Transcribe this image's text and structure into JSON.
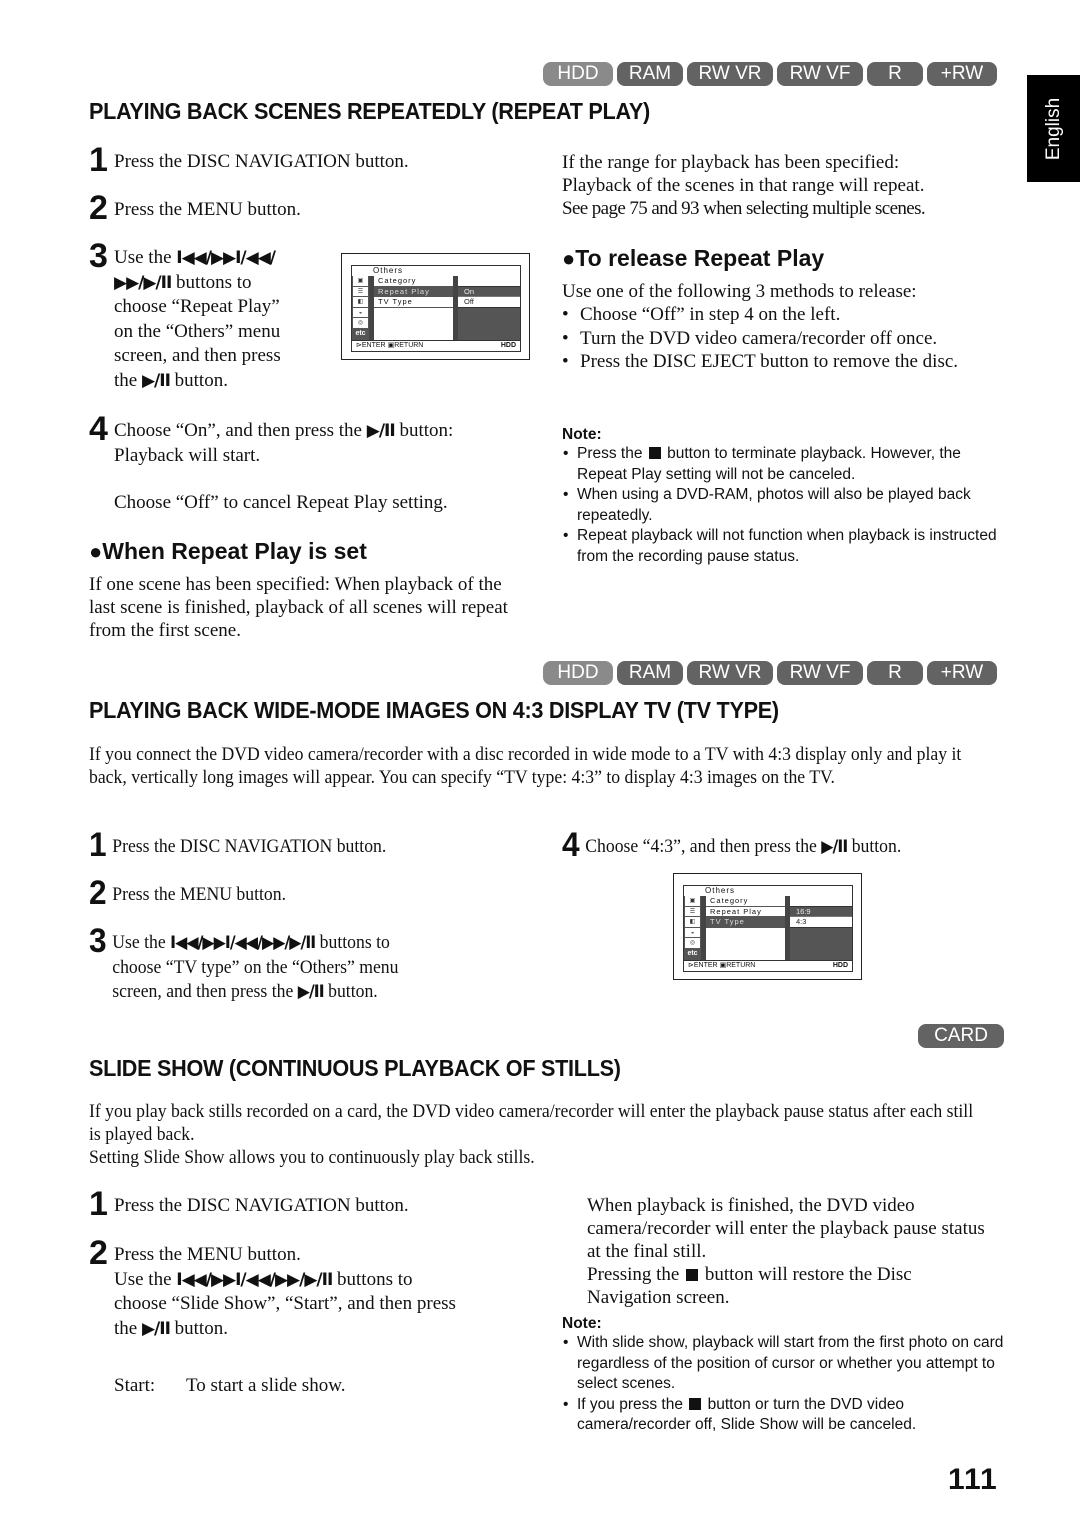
{
  "media_badges_top": [
    "HDD",
    "RAM",
    "RW VR",
    "RW VF",
    "R",
    "+RW"
  ],
  "language_tab": "English",
  "repeat_play": {
    "heading": "PLAYING BACK SCENES REPEATEDLY (REPEAT PLAY)",
    "steps": [
      {
        "num": "1",
        "text": "Press the DISC NAVIGATION button."
      },
      {
        "num": "2",
        "text": "Press the MENU button."
      },
      {
        "num": "3",
        "pre": "Use the",
        "glyphs_line1": "I◀◀/▶▶I/◀◀/",
        "glyphs_line2": "▶▶/▶/II",
        "after_glyphs": "buttons to",
        "lines": [
          "choose “Repeat Play”",
          "on the “Others” menu",
          "screen, and then press"
        ],
        "last_pre": "the",
        "last_glyph": "▶/II",
        "last_post": "button."
      },
      {
        "num": "4",
        "pre": "Choose “On”, and then press the",
        "glyph": "▶/II",
        "post": "button:",
        "line2": "Playback will start.",
        "extra": "Choose “Off” to cancel Repeat Play setting."
      }
    ],
    "menu_screen": {
      "title": "Others",
      "icons": [
        "camera-icon",
        "list-icon",
        "media-icon",
        "disc-icon",
        "dvd-icon",
        "etc"
      ],
      "etc_label": "etc",
      "items": [
        "Category",
        "Repeat Play",
        "TV Type"
      ],
      "selected_item": "Repeat Play",
      "options": [
        "On",
        "Off"
      ],
      "selected_option": "On",
      "footer_enter": "ENTER",
      "footer_return": "RETURN",
      "footer_media": "HDD"
    },
    "range_text": [
      "If the range for playback has been specified:",
      "Playback of the scenes in that range will repeat.",
      "See page 75 and 93 when selecting multiple scenes."
    ],
    "release": {
      "heading": "To release Repeat Play",
      "intro": "Use one of the following 3 methods to release:",
      "bullets": [
        "Choose “Off” in step 4 on the left.",
        "Turn the DVD video camera/recorder off once.",
        "Press the DISC EJECT button to remove the disc."
      ]
    },
    "note": {
      "title": "Note:",
      "items": [
        {
          "pre": "Press the",
          "post": "button to terminate playback. However, the Repeat Play setting will not be canceled."
        },
        {
          "text": "When using a DVD-RAM, photos will also be played back repeatedly."
        },
        {
          "text": "Repeat playback will not function when playback is instructed from the recording pause status."
        }
      ]
    },
    "when_set": {
      "heading": "When Repeat Play is set",
      "text": "If one scene has been specified: When playback of the last scene is finished, playback of all scenes will repeat from the first scene."
    }
  },
  "media_badges_mid": [
    "HDD",
    "RAM",
    "RW VR",
    "RW VF",
    "R",
    "+RW"
  ],
  "tv_type": {
    "heading": "PLAYING BACK WIDE-MODE IMAGES ON 4:3 DISPLAY TV (TV TYPE)",
    "intro": "If you connect the DVD video camera/recorder with a disc recorded in wide mode to a TV with 4:3 display only and play it back, vertically long images will appear. You can specify “TV type: 4:3” to display 4:3 images on the TV.",
    "steps": [
      {
        "num": "1",
        "text": "Press the DISC NAVIGATION button."
      },
      {
        "num": "2",
        "text": "Press the MENU button."
      },
      {
        "num": "3",
        "pre": "Use the",
        "glyphs": "I◀◀/▶▶I/◀◀/▶▶/▶/II",
        "post": "buttons to",
        "line2": "choose “TV type” on the “Others” menu",
        "line3_pre": "screen, and then press the",
        "line3_glyph": "▶/II",
        "line3_post": "button."
      },
      {
        "num": "4",
        "pre": "Choose “4:3”, and then press the",
        "glyph": "▶/II",
        "post": "button."
      }
    ],
    "menu_screen": {
      "title": "Others",
      "items": [
        "Category",
        "Repeat Play",
        "TV Type"
      ],
      "selected_item": "TV Type",
      "options": [
        "16:9",
        "4:3"
      ],
      "selected_option": "4:3",
      "etc_label": "etc",
      "footer_enter": "ENTER",
      "footer_return": "RETURN",
      "footer_media": "HDD"
    }
  },
  "card_badge": "CARD",
  "slide_show": {
    "heading": "SLIDE SHOW (CONTINUOUS PLAYBACK OF STILLS)",
    "intro": [
      "If you play back stills recorded on a card, the DVD video camera/recorder will enter the playback pause status after each still is played back.",
      "Setting Slide Show allows you to continuously play back stills."
    ],
    "steps": [
      {
        "num": "1",
        "text": "Press the DISC NAVIGATION button."
      },
      {
        "num": "2",
        "text": "Press the MENU button.",
        "line2_pre": "Use the",
        "line2_glyphs": "I◀◀/▶▶I/◀◀/▶▶/▶/II",
        "line2_post": "buttons to",
        "line3": "choose “Slide Show”, “Start”, and then press",
        "line4_pre": "the",
        "line4_glyph": "▶/II",
        "line4_post": "button."
      }
    ],
    "start_label": "Start:",
    "start_desc": "To start a slide show.",
    "finish_text": "When playback is finished, the DVD video camera/recorder will enter the playback pause status at the final still.",
    "restore_pre": "Pressing the",
    "restore_post": "button will restore the Disc Navigation screen.",
    "note": {
      "title": "Note:",
      "items": [
        {
          "text": "With slide show, playback will start from the first photo on card regardless of the position of cursor or whether you attempt to select scenes."
        },
        {
          "pre": "If you press the",
          "post": "button or turn the DVD video camera/recorder off, Slide Show will be canceled."
        }
      ]
    }
  },
  "page_number": "111"
}
